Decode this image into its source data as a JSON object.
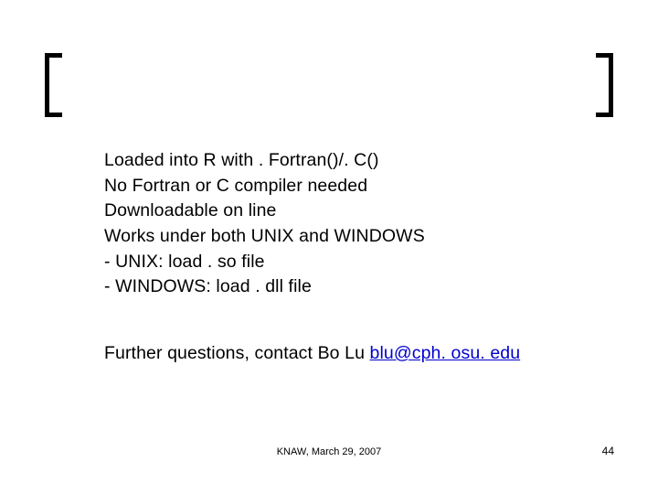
{
  "body": {
    "line1": "Loaded into R with . Fortran()/. C()",
    "line2": "No Fortran or C compiler needed",
    "line3": "Downloadable on line",
    "line4": "Works under both UNIX and WINDOWS",
    "line5": "- UNIX: load . so file",
    "line6": "- WINDOWS: load . dll file"
  },
  "contact": {
    "prefix": "Further questions, contact Bo Lu ",
    "email": "blu@cph. osu. edu",
    "mailto": "mailto:blu@cph.osu.edu"
  },
  "footer": {
    "center": "KNAW, March 29, 2007",
    "page": "44"
  }
}
